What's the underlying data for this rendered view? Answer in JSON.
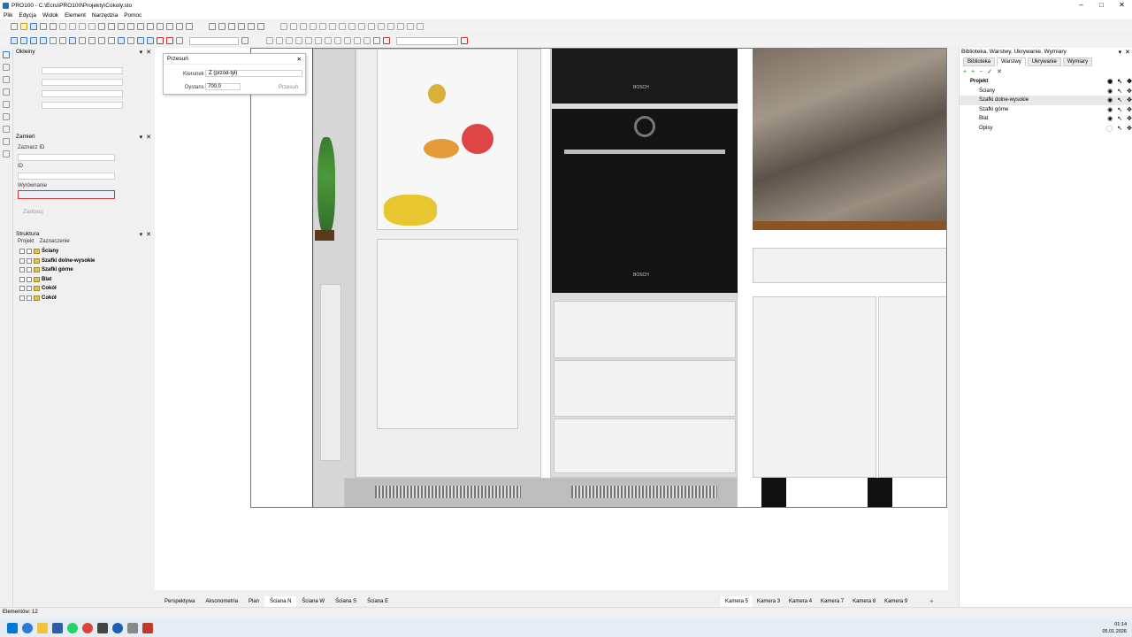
{
  "window": {
    "title": "PRO100 - C:\\Ecru\\PRO100\\Projekty\\Cokoly.sto",
    "min": "–",
    "max": "□",
    "close": "✕"
  },
  "menu": [
    "Plik",
    "Edycja",
    "Widok",
    "Element",
    "Narzędzia",
    "Pomoc"
  ],
  "panels": {
    "okleiny": {
      "title": "Okleiny"
    },
    "zamien": {
      "title": "Zamień",
      "select_label": "Zaznacz ID",
      "id_label": "ID",
      "align_label": "Wyrównanie",
      "apply_label": "Zastosuj"
    },
    "struktura": {
      "title": "Struktura",
      "tab_project": "Projekt",
      "tab_selection": "Zaznaczenie",
      "items": [
        "Ściany",
        "Szafki dolne-wysokie",
        "Szafki górne",
        "Blat",
        "Cokół",
        "Cokół"
      ]
    }
  },
  "dialog": {
    "title": "Przesuń",
    "direction_label": "Kierunek",
    "direction_value": "Z (przód-tył)",
    "distance_label": "Dystans",
    "distance_value": "700,0",
    "move_button": "Przesuń",
    "close": "✕"
  },
  "appliance": {
    "brand": "BOSCH"
  },
  "right_panel": {
    "title": "Biblioteka, Warstwy, Ukrywanie, Wymiary",
    "tabs": [
      "Biblioteka",
      "Warstwy",
      "Ukrywanie",
      "Wymiary"
    ],
    "project_label": "Projekt",
    "layers": [
      "Ściany",
      "Szafki dolne-wysokie",
      "Szafki górne",
      "Blat",
      "Opisy"
    ]
  },
  "view_tabs": [
    "Perspektywa",
    "Aksonometria",
    "Plan",
    "Ściana N",
    "Ściana W",
    "Ściana S",
    "Ściana E"
  ],
  "active_view": "Ściana N",
  "camera_tabs": [
    "Kamera 5",
    "Kamera 3",
    "Kamera 4",
    "Kamera 7",
    "Kamera 8",
    "Kamera 9"
  ],
  "add_tab": "+",
  "status": {
    "elements": "Elementów: 12"
  },
  "tray": {
    "time": "01:14",
    "date": "05.01.2026"
  }
}
